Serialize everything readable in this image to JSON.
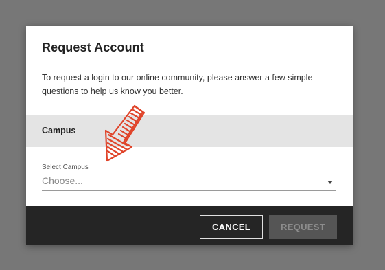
{
  "dialog": {
    "title": "Request Account",
    "intro": "To request a login to our online community, please answer a few simple questions to help us know you better.",
    "section_title": "Campus",
    "field": {
      "label": "Select Campus",
      "value": "Choose..."
    },
    "cancel_label": "CANCEL",
    "request_label": "REQUEST"
  },
  "annotation": {
    "arrow_icon": "hand-drawn-arrow-icon",
    "arrow_color": "#e0442a"
  },
  "colors": {
    "overlay": "#777777",
    "section_bg": "#e4e4e4",
    "footer_bg": "#252525"
  }
}
